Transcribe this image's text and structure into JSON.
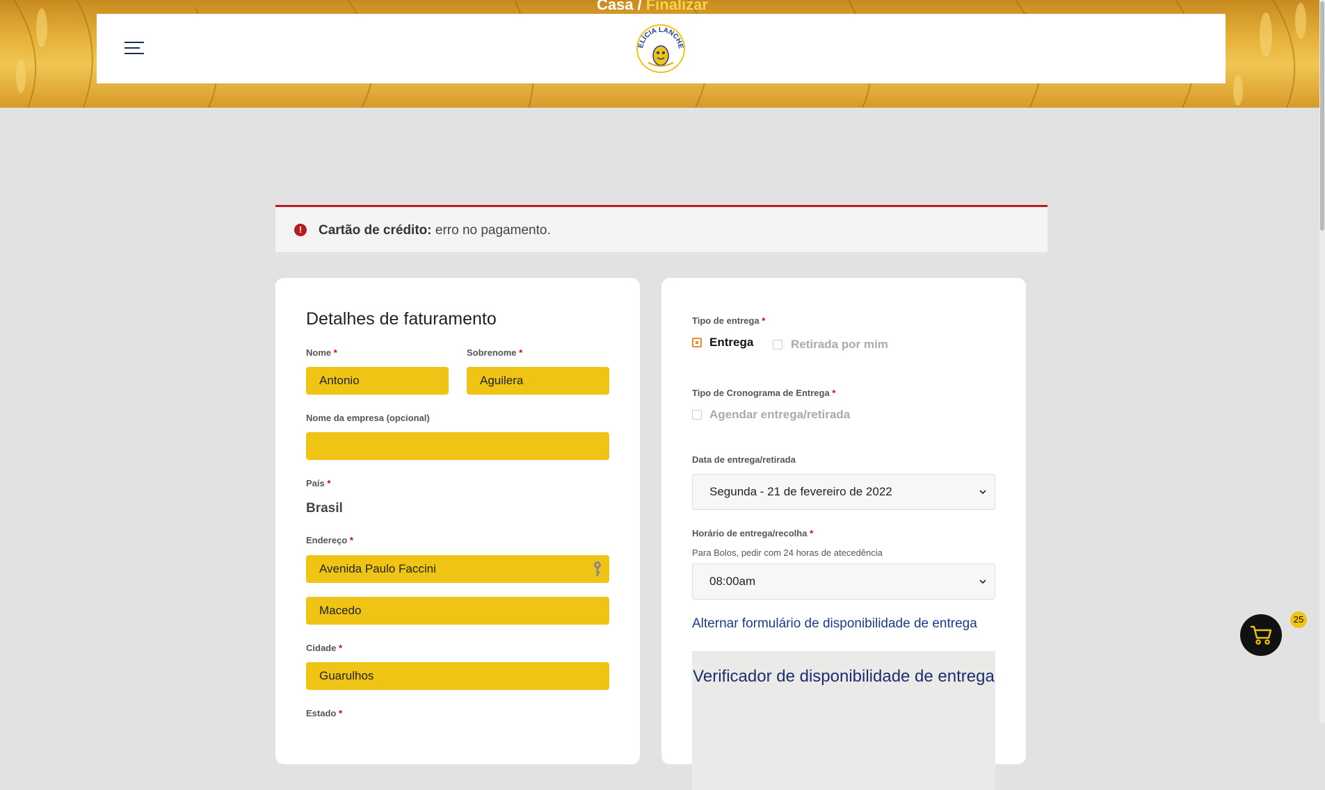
{
  "header": {
    "breadcrumb": {
      "home": "Casa",
      "separator": "/",
      "current": "Finalizar"
    },
    "logo_text": "DELÍCIA LANCHES",
    "menu_icon": "hamburger-menu-icon"
  },
  "notice": {
    "icon": "error-exclamation-icon",
    "label": "Cartão de crédito:",
    "message": "erro no pagamento."
  },
  "billing": {
    "title": "Detalhes de faturamento",
    "first_name": {
      "label": "Nome",
      "required": "*",
      "value": "Antonio"
    },
    "last_name": {
      "label": "Sobrenome",
      "required": "*",
      "value": "Aguilera"
    },
    "company": {
      "label": "Nome da empresa (opcional)",
      "value": ""
    },
    "country": {
      "label": "País",
      "required": "*",
      "value": "Brasil"
    },
    "address": {
      "label": "Endereço",
      "required": "*",
      "line1": "Avenida Paulo Faccini",
      "line2": "Macedo"
    },
    "city": {
      "label": "Cidade",
      "required": "*",
      "value": "Guarulhos"
    },
    "state": {
      "label": "Estado",
      "required": "*"
    }
  },
  "delivery": {
    "type": {
      "label": "Tipo de entrega",
      "required": "*",
      "options": [
        {
          "label": "Entrega",
          "checked": true
        },
        {
          "label": "Retirada por mim",
          "checked": false
        }
      ]
    },
    "schedule_type": {
      "label": "Tipo de Cronograma de Entrega",
      "required": "*",
      "option": "Agendar entrega/retirada"
    },
    "date": {
      "label": "Data de entrega/retirada",
      "value": "Segunda - 21 de fevereiro de 2022"
    },
    "time": {
      "label": "Horário de entrega/recolha",
      "required": "*",
      "hint": "Para Bolos, pedir com 24 horas de atecedência",
      "value": "08:00am"
    },
    "toggle_link": "Alternar formulário de disponibilidade de entrega",
    "checker_title": "Verificador de disponibilidade de entrega"
  },
  "cart": {
    "icon": "shopping-cart-icon",
    "count": "25"
  },
  "colors": {
    "accent_yellow": "#f0c414",
    "error_red": "#b81c23",
    "link_blue": "#1b3a8c",
    "checkbox_orange": "#ef8a2a"
  }
}
